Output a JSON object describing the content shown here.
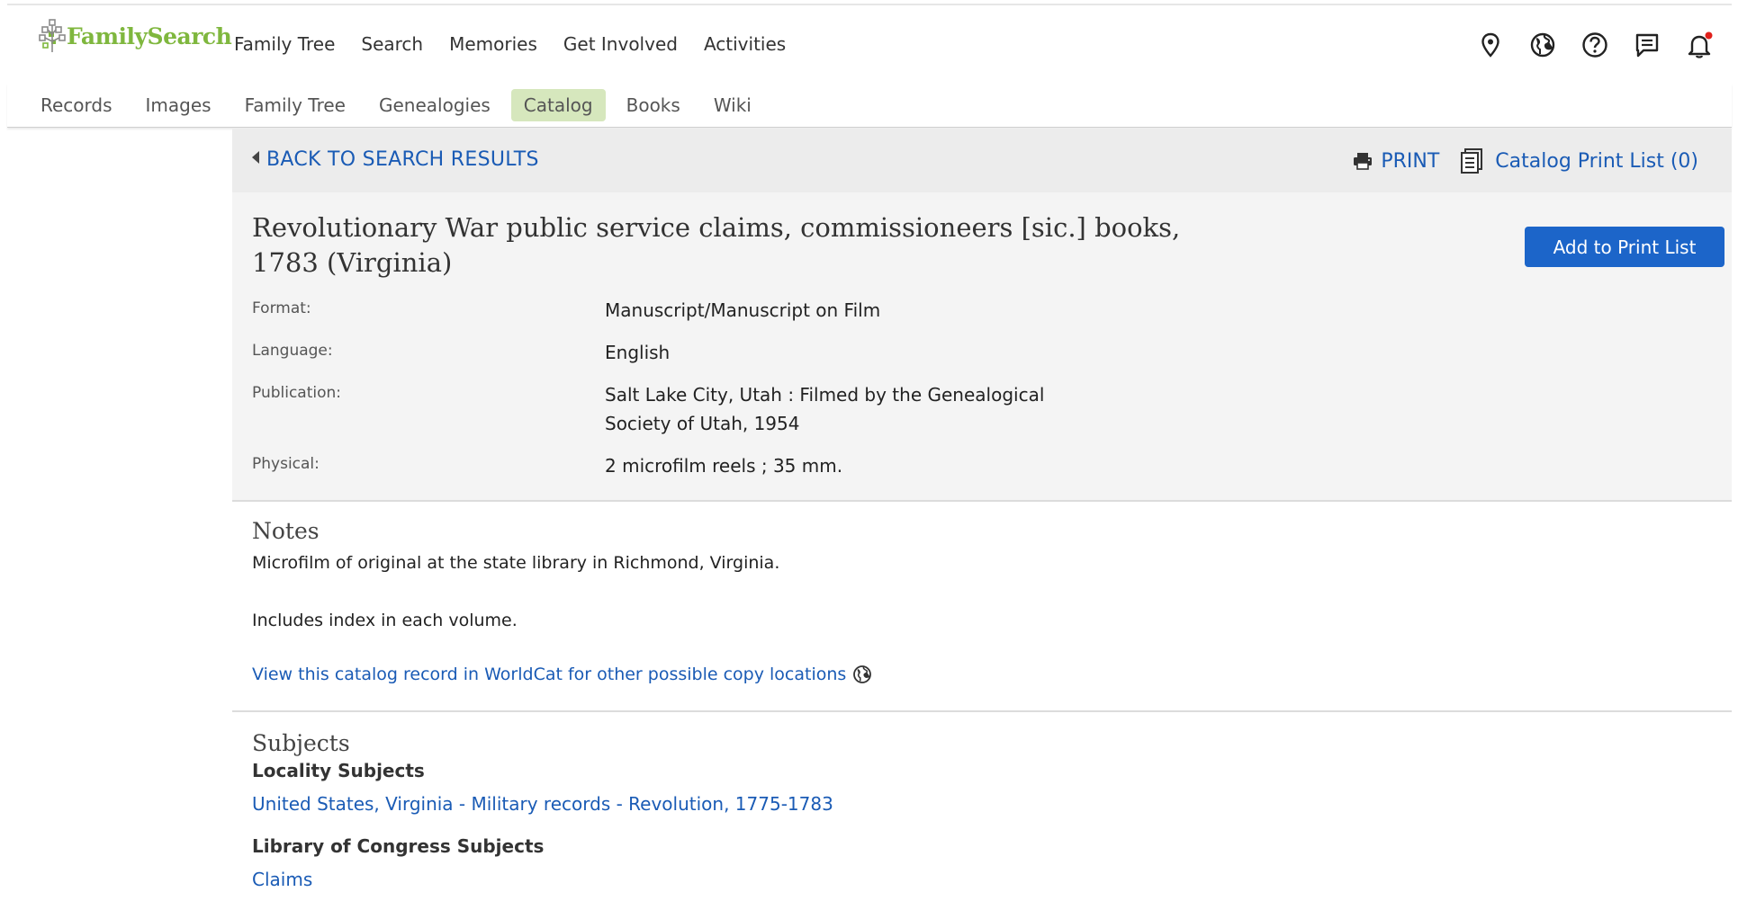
{
  "brand": {
    "name": "FamilySearch"
  },
  "main_nav": [
    "Family Tree",
    "Search",
    "Memories",
    "Get Involved",
    "Activities"
  ],
  "top_icons": [
    "location-pin-icon",
    "globe-icon",
    "help-icon",
    "messages-icon",
    "notifications-bell-icon"
  ],
  "sub_nav": {
    "items": [
      "Records",
      "Images",
      "Family Tree",
      "Genealogies",
      "Catalog",
      "Books",
      "Wiki"
    ],
    "active": "Catalog"
  },
  "back_link": "BACK TO SEARCH RESULTS",
  "print_label": "PRINT",
  "catalog_print_list": "Catalog Print List (0)",
  "record": {
    "title_line1": "Revolutionary War public service claims, commissioneers [sic.] books,",
    "title_line2": "1783 (Virginia)",
    "add_button": "Add to Print List",
    "fields": [
      {
        "label": "Format:",
        "value": "Manuscript/Manuscript on Film"
      },
      {
        "label": "Language:",
        "value": "English"
      },
      {
        "label": "Publication:",
        "value": "Salt Lake City, Utah : Filmed by the Genealogical",
        "value2": "Society of Utah, 1954"
      },
      {
        "label": "Physical:",
        "value": "2 microfilm reels ; 35 mm."
      }
    ]
  },
  "notes": {
    "heading": "Notes",
    "line1": "Microfilm of original at the state library in Richmond, Virginia.",
    "line2": "Includes index in each volume.",
    "worldcat_link": "View this catalog record in WorldCat for other possible copy locations"
  },
  "subjects": {
    "heading": "Subjects",
    "locality_heading": "Locality Subjects",
    "locality_link": "United States, Virginia - Military records - Revolution, 1775-1783",
    "loc_heading": "Library of Congress Subjects",
    "loc_link": "Claims"
  },
  "colors": {
    "link": "#1a5bb5",
    "button": "#1c65c9",
    "brand_green": "#7fb73e",
    "active_tab": "#d6e7bd",
    "notification_dot": "#e0201b"
  }
}
